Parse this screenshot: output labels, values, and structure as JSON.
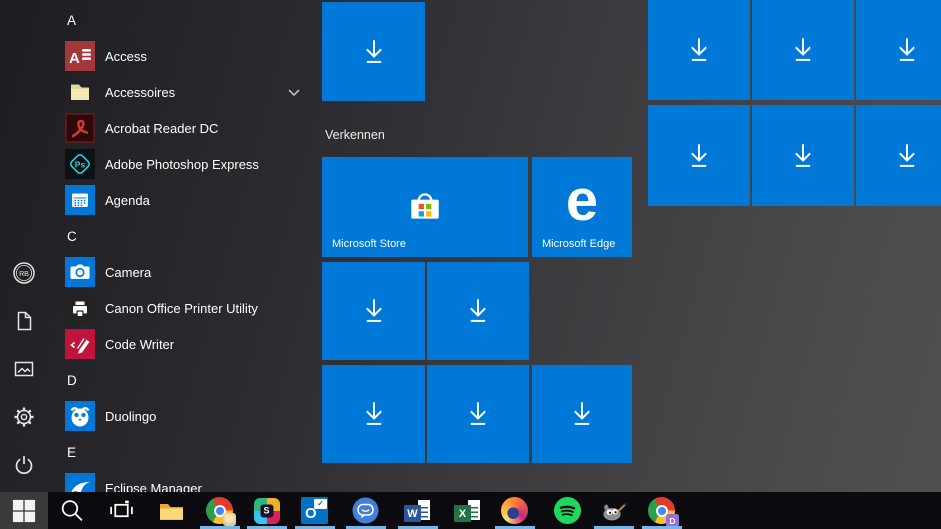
{
  "colors": {
    "accent_blue": "#0078D7",
    "taskbar_underline": "#75b8e8"
  },
  "start_menu": {
    "user_initials": "RB",
    "app_list": {
      "sections": [
        {
          "letter": "A",
          "apps": [
            "Access",
            "Accessoires",
            "Acrobat Reader DC",
            "Adobe Photoshop Express",
            "Agenda"
          ]
        },
        {
          "letter": "C",
          "apps": [
            "Camera",
            "Canon Office Printer Utility",
            "Code Writer"
          ]
        },
        {
          "letter": "D",
          "apps": [
            "Duolingo"
          ]
        },
        {
          "letter": "E",
          "apps": [
            "Eclipse Manager"
          ]
        }
      ],
      "expandable_item": "Accessoires"
    },
    "tiles": {
      "group_label": "Verkennen",
      "store_label": "Microsoft Store",
      "edge_label": "Microsoft Edge",
      "edge_letter": "e",
      "pending_download_tiles": 12
    }
  },
  "taskbar": {
    "icon_letters": {
      "slack": "S",
      "outlook": "O",
      "outlook_check": "✓",
      "word": "W",
      "excel": "X",
      "chrome_profile_badge": "D"
    },
    "items": [
      {
        "name": "start",
        "running": false
      },
      {
        "name": "search",
        "running": false
      },
      {
        "name": "task-view",
        "running": false
      },
      {
        "name": "file-explorer",
        "running": false
      },
      {
        "name": "chrome",
        "running": true
      },
      {
        "name": "slack",
        "running": true
      },
      {
        "name": "outlook",
        "running": true
      },
      {
        "name": "chat",
        "running": true
      },
      {
        "name": "word",
        "running": true
      },
      {
        "name": "excel",
        "running": false
      },
      {
        "name": "firefox",
        "running": true
      },
      {
        "name": "spotify",
        "running": false
      },
      {
        "name": "gimp",
        "running": true
      },
      {
        "name": "chrome-profile-d",
        "running": true
      }
    ]
  }
}
